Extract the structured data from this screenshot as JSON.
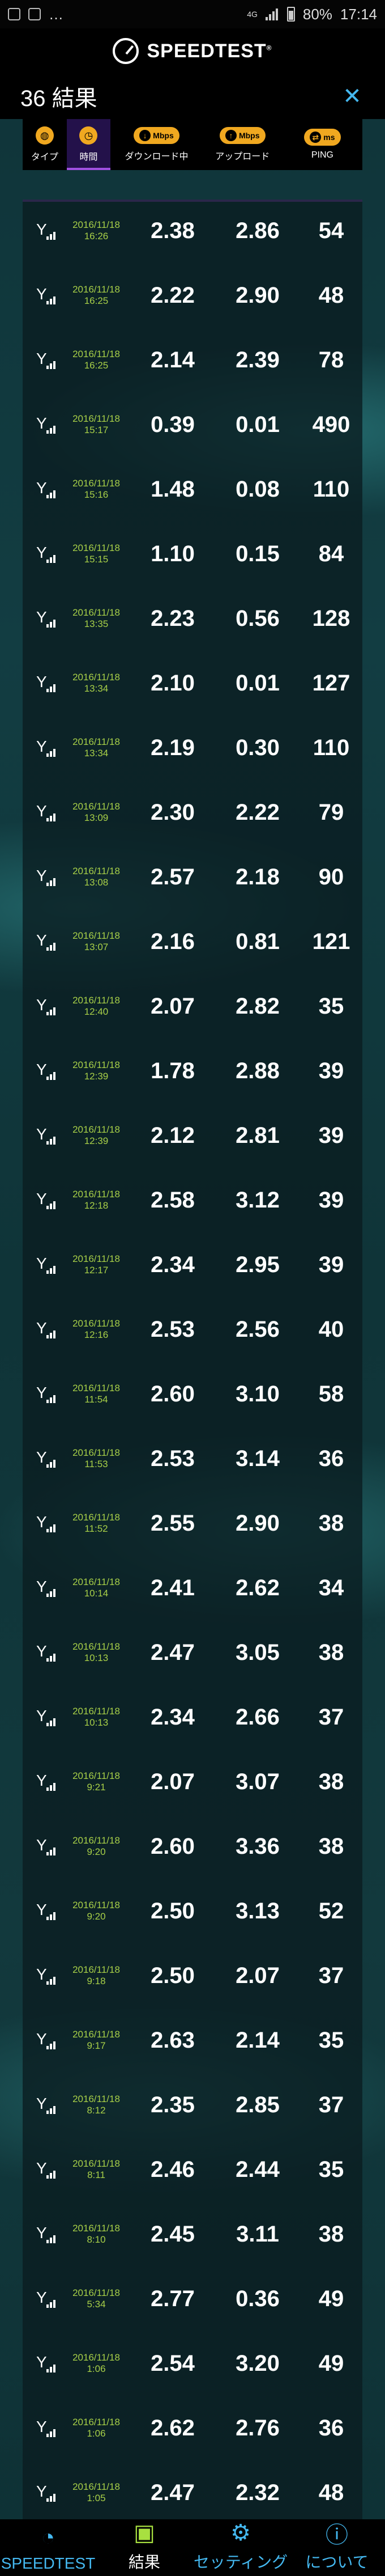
{
  "status": {
    "time": "17:14",
    "battery": "80%",
    "network": "4G"
  },
  "header": {
    "brand": "SPEEDTEST",
    "tm": "®"
  },
  "results": {
    "count_label": "36 結果"
  },
  "tabs": [
    {
      "label": "タイプ",
      "icon": "globe-icon",
      "active": false
    },
    {
      "label": "時間",
      "icon": "clock-icon",
      "active": true
    },
    {
      "label": "ダウンロード中",
      "icon": "download-icon",
      "unit": "Mbps",
      "active": false
    },
    {
      "label": "アップロード",
      "icon": "upload-icon",
      "unit": "Mbps",
      "active": false
    },
    {
      "label": "PING",
      "icon": "ping-icon",
      "unit": "ms",
      "active": false
    }
  ],
  "rows": [
    {
      "date": "2016/11/18",
      "time": "16:26",
      "download": "2.38",
      "upload": "2.86",
      "ping": "54"
    },
    {
      "date": "2016/11/18",
      "time": "16:25",
      "download": "2.22",
      "upload": "2.90",
      "ping": "48"
    },
    {
      "date": "2016/11/18",
      "time": "16:25",
      "download": "2.14",
      "upload": "2.39",
      "ping": "78"
    },
    {
      "date": "2016/11/18",
      "time": "15:17",
      "download": "0.39",
      "upload": "0.01",
      "ping": "490"
    },
    {
      "date": "2016/11/18",
      "time": "15:16",
      "download": "1.48",
      "upload": "0.08",
      "ping": "110"
    },
    {
      "date": "2016/11/18",
      "time": "15:15",
      "download": "1.10",
      "upload": "0.15",
      "ping": "84"
    },
    {
      "date": "2016/11/18",
      "time": "13:35",
      "download": "2.23",
      "upload": "0.56",
      "ping": "128"
    },
    {
      "date": "2016/11/18",
      "time": "13:34",
      "download": "2.10",
      "upload": "0.01",
      "ping": "127"
    },
    {
      "date": "2016/11/18",
      "time": "13:34",
      "download": "2.19",
      "upload": "0.30",
      "ping": "110"
    },
    {
      "date": "2016/11/18",
      "time": "13:09",
      "download": "2.30",
      "upload": "2.22",
      "ping": "79"
    },
    {
      "date": "2016/11/18",
      "time": "13:08",
      "download": "2.57",
      "upload": "2.18",
      "ping": "90"
    },
    {
      "date": "2016/11/18",
      "time": "13:07",
      "download": "2.16",
      "upload": "0.81",
      "ping": "121"
    },
    {
      "date": "2016/11/18",
      "time": "12:40",
      "download": "2.07",
      "upload": "2.82",
      "ping": "35"
    },
    {
      "date": "2016/11/18",
      "time": "12:39",
      "download": "1.78",
      "upload": "2.88",
      "ping": "39"
    },
    {
      "date": "2016/11/18",
      "time": "12:39",
      "download": "2.12",
      "upload": "2.81",
      "ping": "39"
    },
    {
      "date": "2016/11/18",
      "time": "12:18",
      "download": "2.58",
      "upload": "3.12",
      "ping": "39"
    },
    {
      "date": "2016/11/18",
      "time": "12:17",
      "download": "2.34",
      "upload": "2.95",
      "ping": "39"
    },
    {
      "date": "2016/11/18",
      "time": "12:16",
      "download": "2.53",
      "upload": "2.56",
      "ping": "40"
    },
    {
      "date": "2016/11/18",
      "time": "11:54",
      "download": "2.60",
      "upload": "3.10",
      "ping": "58"
    },
    {
      "date": "2016/11/18",
      "time": "11:53",
      "download": "2.53",
      "upload": "3.14",
      "ping": "36"
    },
    {
      "date": "2016/11/18",
      "time": "11:52",
      "download": "2.55",
      "upload": "2.90",
      "ping": "38"
    },
    {
      "date": "2016/11/18",
      "time": "10:14",
      "download": "2.41",
      "upload": "2.62",
      "ping": "34"
    },
    {
      "date": "2016/11/18",
      "time": "10:13",
      "download": "2.47",
      "upload": "3.05",
      "ping": "38"
    },
    {
      "date": "2016/11/18",
      "time": "10:13",
      "download": "2.34",
      "upload": "2.66",
      "ping": "37"
    },
    {
      "date": "2016/11/18",
      "time": "9:21",
      "download": "2.07",
      "upload": "3.07",
      "ping": "38"
    },
    {
      "date": "2016/11/18",
      "time": "9:20",
      "download": "2.60",
      "upload": "3.36",
      "ping": "38"
    },
    {
      "date": "2016/11/18",
      "time": "9:20",
      "download": "2.50",
      "upload": "3.13",
      "ping": "52"
    },
    {
      "date": "2016/11/18",
      "time": "9:18",
      "download": "2.50",
      "upload": "2.07",
      "ping": "37"
    },
    {
      "date": "2016/11/18",
      "time": "9:17",
      "download": "2.63",
      "upload": "2.14",
      "ping": "35"
    },
    {
      "date": "2016/11/18",
      "time": "8:12",
      "download": "2.35",
      "upload": "2.85",
      "ping": "37"
    },
    {
      "date": "2016/11/18",
      "time": "8:11",
      "download": "2.46",
      "upload": "2.44",
      "ping": "35"
    },
    {
      "date": "2016/11/18",
      "time": "8:10",
      "download": "2.45",
      "upload": "3.11",
      "ping": "38"
    },
    {
      "date": "2016/11/18",
      "time": "5:34",
      "download": "2.77",
      "upload": "0.36",
      "ping": "49"
    },
    {
      "date": "2016/11/18",
      "time": "1:06",
      "download": "2.54",
      "upload": "3.20",
      "ping": "49"
    },
    {
      "date": "2016/11/18",
      "time": "1:06",
      "download": "2.62",
      "upload": "2.76",
      "ping": "36"
    },
    {
      "date": "2016/11/18",
      "time": "1:05",
      "download": "2.47",
      "upload": "2.32",
      "ping": "48"
    }
  ],
  "bottom_nav": [
    {
      "label": "SPEEDTEST",
      "icon": "speedometer-icon",
      "active": false
    },
    {
      "label": "結果",
      "icon": "results-icon",
      "active": true
    },
    {
      "label": "セッティング",
      "icon": "gear-icon",
      "active": false
    },
    {
      "label": "について",
      "icon": "info-icon",
      "active": false
    }
  ],
  "colors": {
    "accent": "#a050e0",
    "date_green": "#a8d048",
    "tab_orange": "#f0a820",
    "nav_blue": "#44b8f0"
  }
}
